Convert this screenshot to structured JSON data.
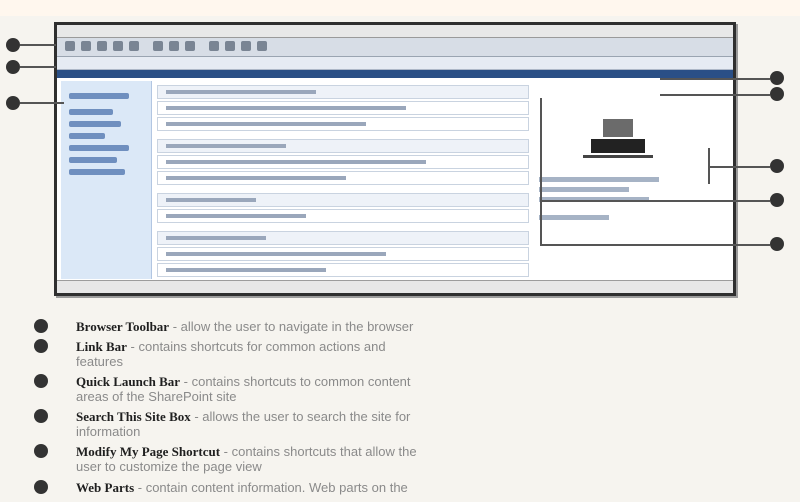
{
  "page_heading": "",
  "descriptions": [
    {
      "term": "Browser Toolbar",
      "text": " - allow the user to navigate in the browser",
      "cont": ""
    },
    {
      "term": "Link Bar",
      "text": " - contains shortcuts for common actions and",
      "cont": "features"
    },
    {
      "term": "Quick Launch Bar",
      "text": " - contains shortcuts to common content",
      "cont": "areas of the SharePoint site"
    },
    {
      "term": "Search This Site Box",
      "text": " - allows the user to search the site for",
      "cont": "information"
    },
    {
      "term": "Modify My Page Shortcut",
      "text": " - contains shortcuts that allow the",
      "cont": "user to customize the page view"
    },
    {
      "term": "Web Parts",
      "text": " - contain content information. Web parts on the",
      "cont": ""
    }
  ],
  "icons": {
    "callout": "callout-number-icon",
    "bullet": "numbered-bullet-icon",
    "logo": "sharepoint-logo-icon"
  },
  "colors": {
    "heading_red": "#d43d3d",
    "ribbon_blue": "#2a4f86",
    "sidebar_blue": "#dbe8f7"
  }
}
